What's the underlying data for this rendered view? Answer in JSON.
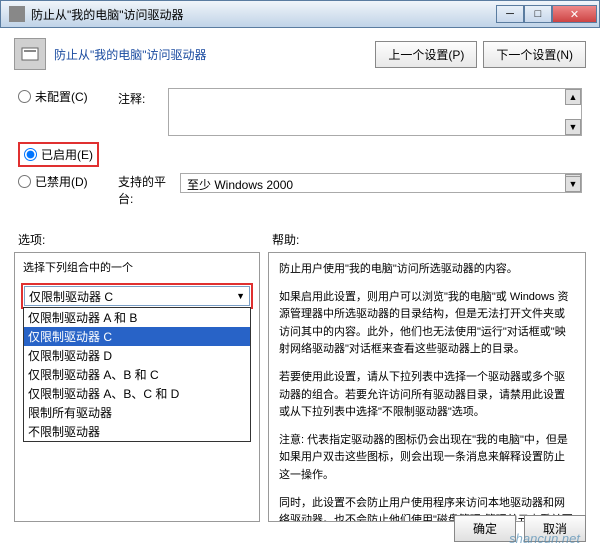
{
  "window": {
    "title": "防止从\"我的电脑\"访问驱动器",
    "header_title": "防止从\"我的电脑\"访问驱动器"
  },
  "nav": {
    "prev": "上一个设置(P)",
    "next": "下一个设置(N)"
  },
  "radios": {
    "not_configured": "未配置(C)",
    "enabled": "已启用(E)",
    "disabled": "已禁用(D)"
  },
  "labels": {
    "comment": "注释:",
    "platform": "支持的平台:",
    "options": "选项:",
    "help": "帮助:",
    "combo_label": "选择下列组合中的一个"
  },
  "platform_value": "至少 Windows 2000",
  "dropdown": {
    "selected": "仅限制驱动器 C",
    "options": [
      "仅限制驱动器 A 和 B",
      "仅限制驱动器 C",
      "仅限制驱动器 D",
      "仅限制驱动器 A、B 和 C",
      "仅限制驱动器 A、B、C 和 D",
      "限制所有驱动器",
      "不限制驱动器"
    ]
  },
  "help_text": {
    "p1": "防止用户使用\"我的电脑\"访问所选驱动器的内容。",
    "p2": "如果启用此设置，则用户可以浏览\"我的电脑\"或 Windows 资源管理器中所选驱动器的目录结构，但是无法打开文件夹或访问其中的内容。此外，他们也无法使用\"运行\"对话框或\"映射网络驱动器\"对话框来查看这些驱动器上的目录。",
    "p3": "若要使用此设置，请从下拉列表中选择一个驱动器或多个驱动器的组合。若要允许访问所有驱动器目录，请禁用此设置或从下拉列表中选择\"不限制驱动器\"选项。",
    "p4": "注意: 代表指定驱动器的图标仍会出现在\"我的电脑\"中，但是如果用户双击这些图标，则会出现一条消息来解释设置防止这一操作。",
    "p5": "同时，此设置不会防止用户使用程序来访问本地驱动器和网络驱动器。也不会防止他们使用\"磁盘管理\"管理单元查看并更改驱动器特性。"
  },
  "buttons": {
    "ok": "确定",
    "cancel": "取消"
  },
  "watermark": "shancun.net"
}
